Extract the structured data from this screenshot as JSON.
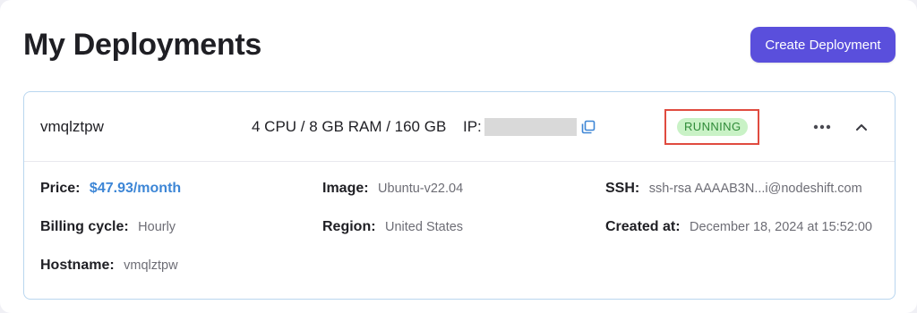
{
  "page": {
    "title": "My Deployments",
    "create_button_label": "Create Deployment"
  },
  "colors": {
    "accent": "#5a4fdc",
    "status_bg": "#c9f2c6",
    "status_text": "#2f8a38",
    "price": "#3d86d6",
    "highlight_border": "#e04b3f",
    "card_border": "#b9d6ef"
  },
  "deployment": {
    "name": "vmqlztpw",
    "specs": "4 CPU / 8 GB RAM / 160 GB",
    "ip_label": "IP:",
    "status": "RUNNING",
    "icons": {
      "copy": "copy-icon",
      "more": "more-horizontal-icon",
      "collapse": "chevron-up-icon"
    },
    "details": {
      "price": {
        "label": "Price:",
        "value": "$47.93/month"
      },
      "billing_cycle": {
        "label": "Billing cycle:",
        "value": "Hourly"
      },
      "hostname": {
        "label": "Hostname:",
        "value": "vmqlztpw"
      },
      "image": {
        "label": "Image:",
        "value": "Ubuntu-v22.04"
      },
      "region": {
        "label": "Region:",
        "value": "United States"
      },
      "ssh": {
        "label": "SSH:",
        "value": "ssh-rsa AAAAB3N...i@nodeshift.com"
      },
      "created_at": {
        "label": "Created at:",
        "value": "December 18, 2024 at 15:52:00"
      }
    }
  }
}
